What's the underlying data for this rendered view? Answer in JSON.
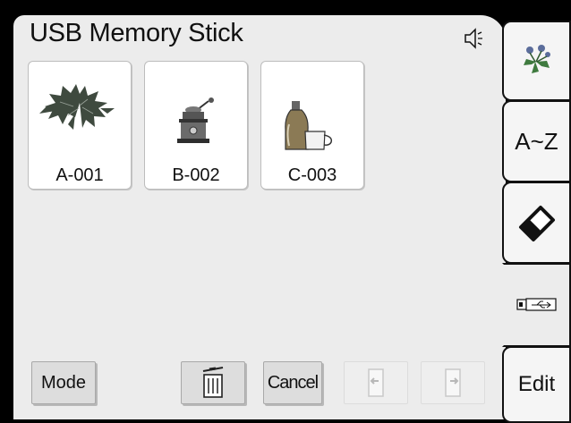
{
  "header": {
    "title": "USB Memory Stick"
  },
  "speaker_icon": "speaker-icon",
  "files": [
    {
      "label": "A-001",
      "icon": "poinsettia-embroidery-icon"
    },
    {
      "label": "B-002",
      "icon": "coffee-grinder-embroidery-icon"
    },
    {
      "label": "C-003",
      "icon": "bottle-cup-embroidery-icon"
    }
  ],
  "buttons": {
    "mode_label": "Mode",
    "cancel_label": "Cancel",
    "delete_icon": "trash-icon",
    "prev_icon": "page-prev-icon",
    "next_icon": "page-next-icon"
  },
  "tabs": [
    {
      "name": "flower-design-tab",
      "icon": "flower-icon"
    },
    {
      "name": "letters-tab",
      "label": "A~Z"
    },
    {
      "name": "eraser-tab",
      "icon": "eraser-icon"
    },
    {
      "name": "usb-tab",
      "icon": "usb-icon",
      "active": true
    },
    {
      "name": "edit-tab",
      "label": "Edit"
    }
  ]
}
